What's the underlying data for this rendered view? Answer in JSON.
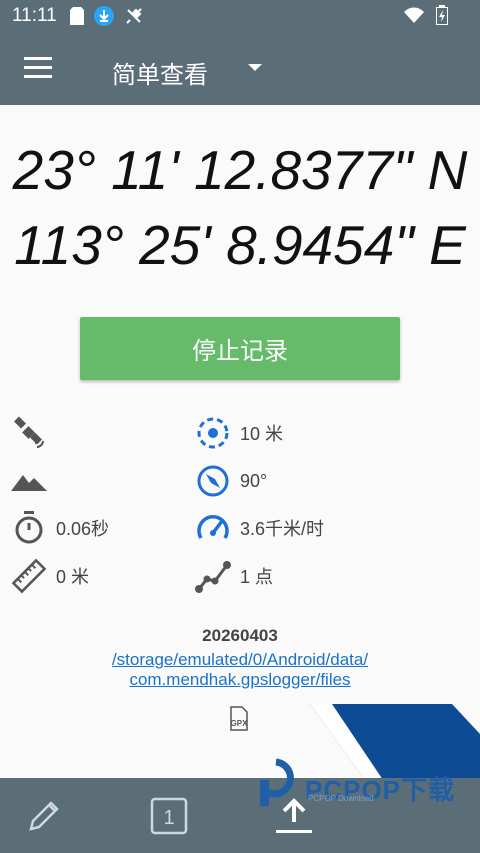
{
  "statusbar": {
    "time": "11:11"
  },
  "appbar": {
    "view_title": "简单查看"
  },
  "coordinates": {
    "latitude": "23° 11' 12.8377\" N",
    "longitude": "113° 25' 8.9454\" E"
  },
  "stop_button": {
    "label": "停止记录"
  },
  "stats": {
    "accuracy": "10 米",
    "bearing": "90°",
    "duration": "0.06秒",
    "speed": "3.6千米/时",
    "distance": "0 米",
    "points": "1 点"
  },
  "file": {
    "date": "20260403",
    "path_line1": "/storage/emulated/0/Android/data/",
    "path_line2": "com.mendhak.gpslogger/files",
    "format_icon_label": "GPX"
  },
  "bottombar": {
    "counter": "1"
  },
  "watermark": {
    "text": "PCPOP下载",
    "sub": "PCPOP Download"
  },
  "colors": {
    "bar": "#5b6e78",
    "accent_green": "#66bb6a",
    "icon_blue": "#1e6fd9",
    "link": "#1a73c8"
  }
}
